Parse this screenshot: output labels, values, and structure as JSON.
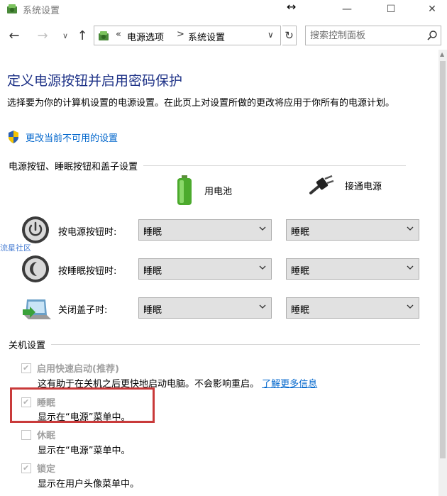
{
  "window": {
    "title": "系统设置",
    "minimize_glyph": "—",
    "maximize_glyph": "☐",
    "close_glyph": "✕",
    "resize_glyph": "↔"
  },
  "nav": {
    "back_glyph": "←",
    "forward_glyph": "→",
    "recent_glyph": "∨",
    "up_glyph": "↑",
    "breadcrumb_prefix": "«",
    "breadcrumbs": [
      "电源选项",
      "系统设置"
    ],
    "breadcrumb_separator": ">",
    "address_dropdown_glyph": "∨",
    "refresh_glyph": "↻",
    "search_placeholder": "搜索控制面板"
  },
  "main": {
    "title": "定义电源按钮并启用密码保护",
    "description": "选择要为你的计算机设置的电源设置。在此页上对设置所做的更改将应用于你所有的电源计划。",
    "change_link": "更改当前不可用的设置",
    "buttons_section_title": "电源按钮、睡眠按钮和盖子设置",
    "column_battery": "用电池",
    "column_plugged": "接通电源",
    "rows": [
      {
        "label": "按电源按钮时:",
        "battery": "睡眠",
        "plugged": "睡眠"
      },
      {
        "label": "按睡眠按钮时:",
        "battery": "睡眠",
        "plugged": "睡眠"
      },
      {
        "label": "关闭盖子时:",
        "battery": "睡眠",
        "plugged": "睡眠"
      }
    ],
    "shutdown_section_title": "关机设置",
    "shutdown_options": [
      {
        "label": "启用快速启动(推荐)",
        "checked": true,
        "desc": "这有助于在关机之后更快地启动电脑。不会影响重启。",
        "link": "了解更多信息"
      },
      {
        "label": "睡眠",
        "checked": true,
        "desc": "显示在“电源”菜单中。"
      },
      {
        "label": "休眠",
        "checked": false,
        "desc": "显示在“电源”菜单中。"
      },
      {
        "label": "锁定",
        "checked": true,
        "desc": "显示在用户头像菜单中。"
      }
    ]
  },
  "watermark": "流星社区",
  "colors": {
    "title_blue": "#1e3287",
    "link_blue": "#0066cc",
    "highlight_red": "#c93a3a"
  }
}
